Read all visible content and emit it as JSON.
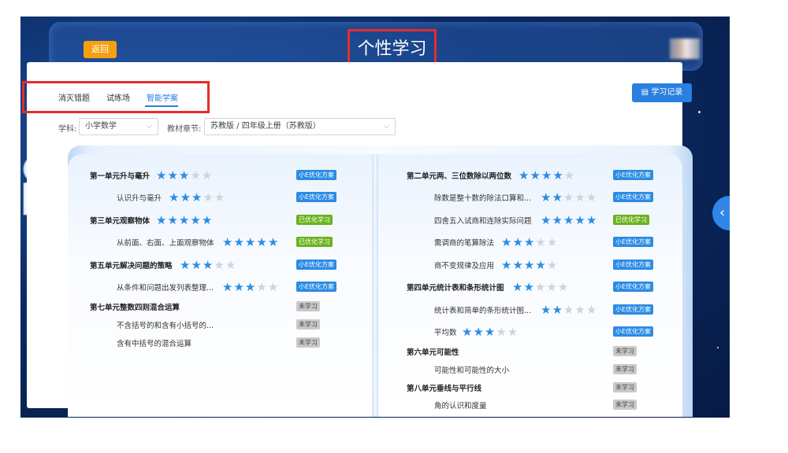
{
  "header": {
    "title": "个性学习",
    "back_label": "返回"
  },
  "tabs": [
    {
      "label": "消灭错题",
      "active": false
    },
    {
      "label": "试练场",
      "active": false
    },
    {
      "label": "智能学案",
      "active": true
    }
  ],
  "record_button": "学习记录",
  "filters": {
    "subject_label": "学科:",
    "subject_value": "小学数学",
    "chapter_label": "教材章节:",
    "chapter_value": "苏教版 / 四年级上册（苏教版）"
  },
  "colors": {
    "accent": "#2a7fe0",
    "back_button": "#f5a00f",
    "green_badge": "#6ab41d",
    "star_on": "#2b8de3"
  },
  "left_rows": [
    {
      "kind": "unit",
      "title": "第一单元升与毫升",
      "stars": 3,
      "badge": "小E优化方案",
      "badge_type": "blue"
    },
    {
      "kind": "lesson",
      "title": "认识升与毫升",
      "stars": 3,
      "badge": "小E优化方案",
      "badge_type": "blue"
    },
    {
      "kind": "unit",
      "title": "第三单元观察物体",
      "stars": 5,
      "badge": "已优化学习",
      "badge_type": "green"
    },
    {
      "kind": "lesson",
      "title": "从前面、右面、上面观察物体",
      "stars": 5,
      "badge": "已优化学习",
      "badge_type": "green"
    },
    {
      "kind": "unit",
      "title": "第五单元解决问题的策略",
      "stars": 3,
      "badge": "小E优化方案",
      "badge_type": "blue"
    },
    {
      "kind": "lesson",
      "title": "从条件和问题出发列表整理...",
      "stars": 3,
      "badge": "小E优化方案",
      "badge_type": "blue"
    },
    {
      "kind": "unit",
      "title": "第七单元整数四则混合运算",
      "stars": null,
      "badge": "未学习",
      "badge_type": "grey"
    },
    {
      "kind": "lesson",
      "title": "不含括号的和含有小括号的...",
      "stars": null,
      "badge": "未学习",
      "badge_type": "grey"
    },
    {
      "kind": "lesson",
      "title": "含有中括号的混合运算",
      "stars": null,
      "badge": "未学习",
      "badge_type": "grey"
    }
  ],
  "right_rows": [
    {
      "kind": "unit",
      "title": "第二单元两、三位数除以两位数",
      "stars": 4,
      "badge": "小E优化方案",
      "badge_type": "blue"
    },
    {
      "kind": "lesson",
      "title": "除数是整十数的除法口算和...",
      "stars": 2,
      "badge": "小E优化方案",
      "badge_type": "blue"
    },
    {
      "kind": "lesson",
      "title": "四舍五入试商和连除实际问题",
      "stars": 5,
      "badge": "已优化学习",
      "badge_type": "green"
    },
    {
      "kind": "lesson",
      "title": "需调商的笔算除法",
      "stars": 3,
      "badge": "小E优化方案",
      "badge_type": "blue"
    },
    {
      "kind": "lesson",
      "title": "商不变规律及应用",
      "stars": 4,
      "badge": "小E优化方案",
      "badge_type": "blue"
    },
    {
      "kind": "unit",
      "title": "第四单元统计表和条形统计图",
      "stars": 2,
      "badge": "小E优化方案",
      "badge_type": "blue"
    },
    {
      "kind": "lesson",
      "title": "统计表和简单的条形统计图...",
      "stars": 2,
      "badge": "小E优化方案",
      "badge_type": "blue"
    },
    {
      "kind": "lesson",
      "title": "平均数",
      "stars": 3,
      "badge": "小E优化方案",
      "badge_type": "blue"
    },
    {
      "kind": "unit",
      "title": "第六单元可能性",
      "stars": null,
      "badge": "未学习",
      "badge_type": "grey"
    },
    {
      "kind": "lesson",
      "title": "可能性和可能性的大小",
      "stars": null,
      "badge": "未学习",
      "badge_type": "grey"
    },
    {
      "kind": "unit",
      "title": "第八单元垂线与平行线",
      "stars": null,
      "badge": "未学习",
      "badge_type": "grey"
    },
    {
      "kind": "lesson",
      "title": "角的认识和度量",
      "stars": null,
      "badge": "未学习",
      "badge_type": "grey"
    }
  ]
}
